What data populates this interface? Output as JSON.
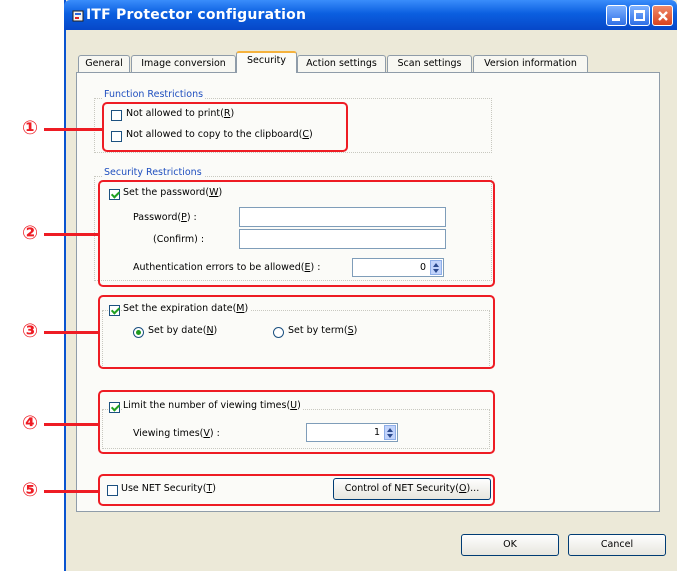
{
  "window": {
    "title": "ITF Protector configuration"
  },
  "tabs": [
    "General",
    "Image conversion",
    "Security",
    "Action settings",
    "Scan settings",
    "Version information"
  ],
  "active_tab": "Security",
  "function_restrictions": {
    "label": "Function Restrictions",
    "print": {
      "text": "Not allowed to print",
      "key": "R",
      "close": ")",
      "checked": false
    },
    "copy": {
      "text": "Not allowed to copy to the clipboard",
      "key": "C",
      "close": ")",
      "checked": false
    }
  },
  "security_restrictions": {
    "label": "Security Restrictions",
    "password": {
      "text": "Set the password",
      "key": "W",
      "close": ")",
      "checked": true
    },
    "password_label": {
      "text": "Password",
      "key": "P",
      "close": ") :"
    },
    "confirm_label": "(Confirm) :",
    "password_value": "",
    "confirm_value": "",
    "auth_errors": {
      "text": "Authentication errors to be allowed",
      "key": "E",
      "close": ") :",
      "value": "0"
    }
  },
  "expiration": {
    "check": {
      "text": "Set the expiration date",
      "key": "M",
      "close": ")",
      "checked": true
    },
    "by_date": {
      "text": "Set by date",
      "key": "N",
      "close": ")",
      "selected": true
    },
    "by_term": {
      "text": "Set by term",
      "key": "S",
      "close": ")",
      "selected": false
    }
  },
  "viewing": {
    "check": {
      "text": "Limit the number of viewing times",
      "key": "U",
      "close": ")",
      "checked": true
    },
    "times_label": {
      "text": "Viewing times",
      "key": "V",
      "close": ") :"
    },
    "times_value": "1"
  },
  "net_security": {
    "check": {
      "text": "Use NET Security",
      "key": "T",
      "close": ")",
      "checked": false
    },
    "control_button": {
      "text": "Control of NET Security",
      "key": "O",
      "close": ")..."
    }
  },
  "buttons": {
    "ok": "OK",
    "cancel": "Cancel"
  },
  "callouts": [
    "①",
    "②",
    "③",
    "④",
    "⑤"
  ],
  "colors": {
    "highlight": "#ee1c24",
    "titlebar": "#0b5fe0",
    "window_bg": "#ece9d8",
    "group_label": "#1f4fbf"
  }
}
